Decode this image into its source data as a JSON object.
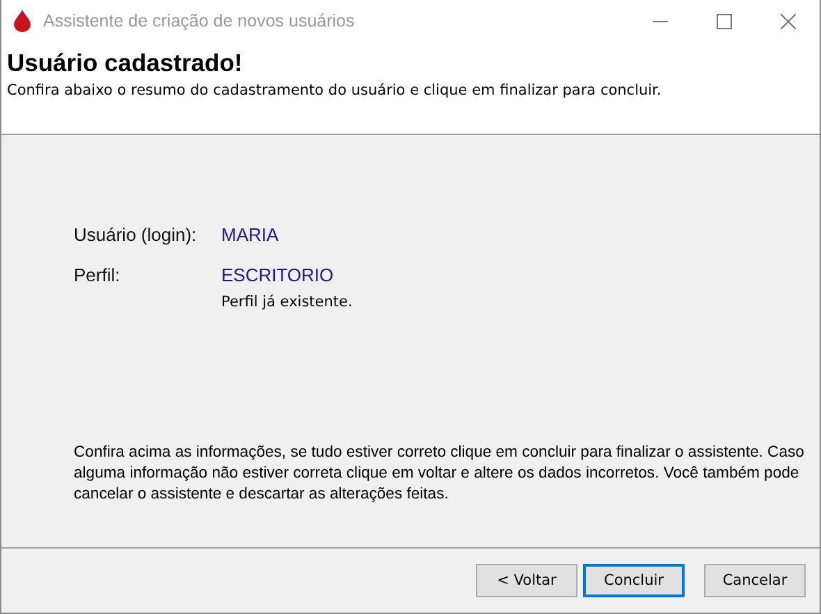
{
  "window": {
    "title": "Assistente de criação de novos usuários"
  },
  "header": {
    "title": "Usuário cadastrado!",
    "subtitle": "Confira abaixo o resumo do cadastramento do usuário e clique em finalizar para concluir."
  },
  "fields": [
    {
      "label": "Usuário (login):",
      "value": "MARIA"
    },
    {
      "label": "Perfil:",
      "value": "ESCRITORIO",
      "note": "Perfil já existente."
    }
  ],
  "info": "Confira acima as informações, se tudo estiver correto clique em concluir para finalizar o assistente. Caso alguma informação não estiver correta clique em voltar e altere os dados incorretos. Você também pode cancelar o assistente e descartar as alterações feitas.",
  "buttons": [
    {
      "label": "< Voltar",
      "default": false
    },
    {
      "label": "Concluir",
      "default": true
    },
    {
      "label": "Cancelar",
      "default": false
    }
  ]
}
